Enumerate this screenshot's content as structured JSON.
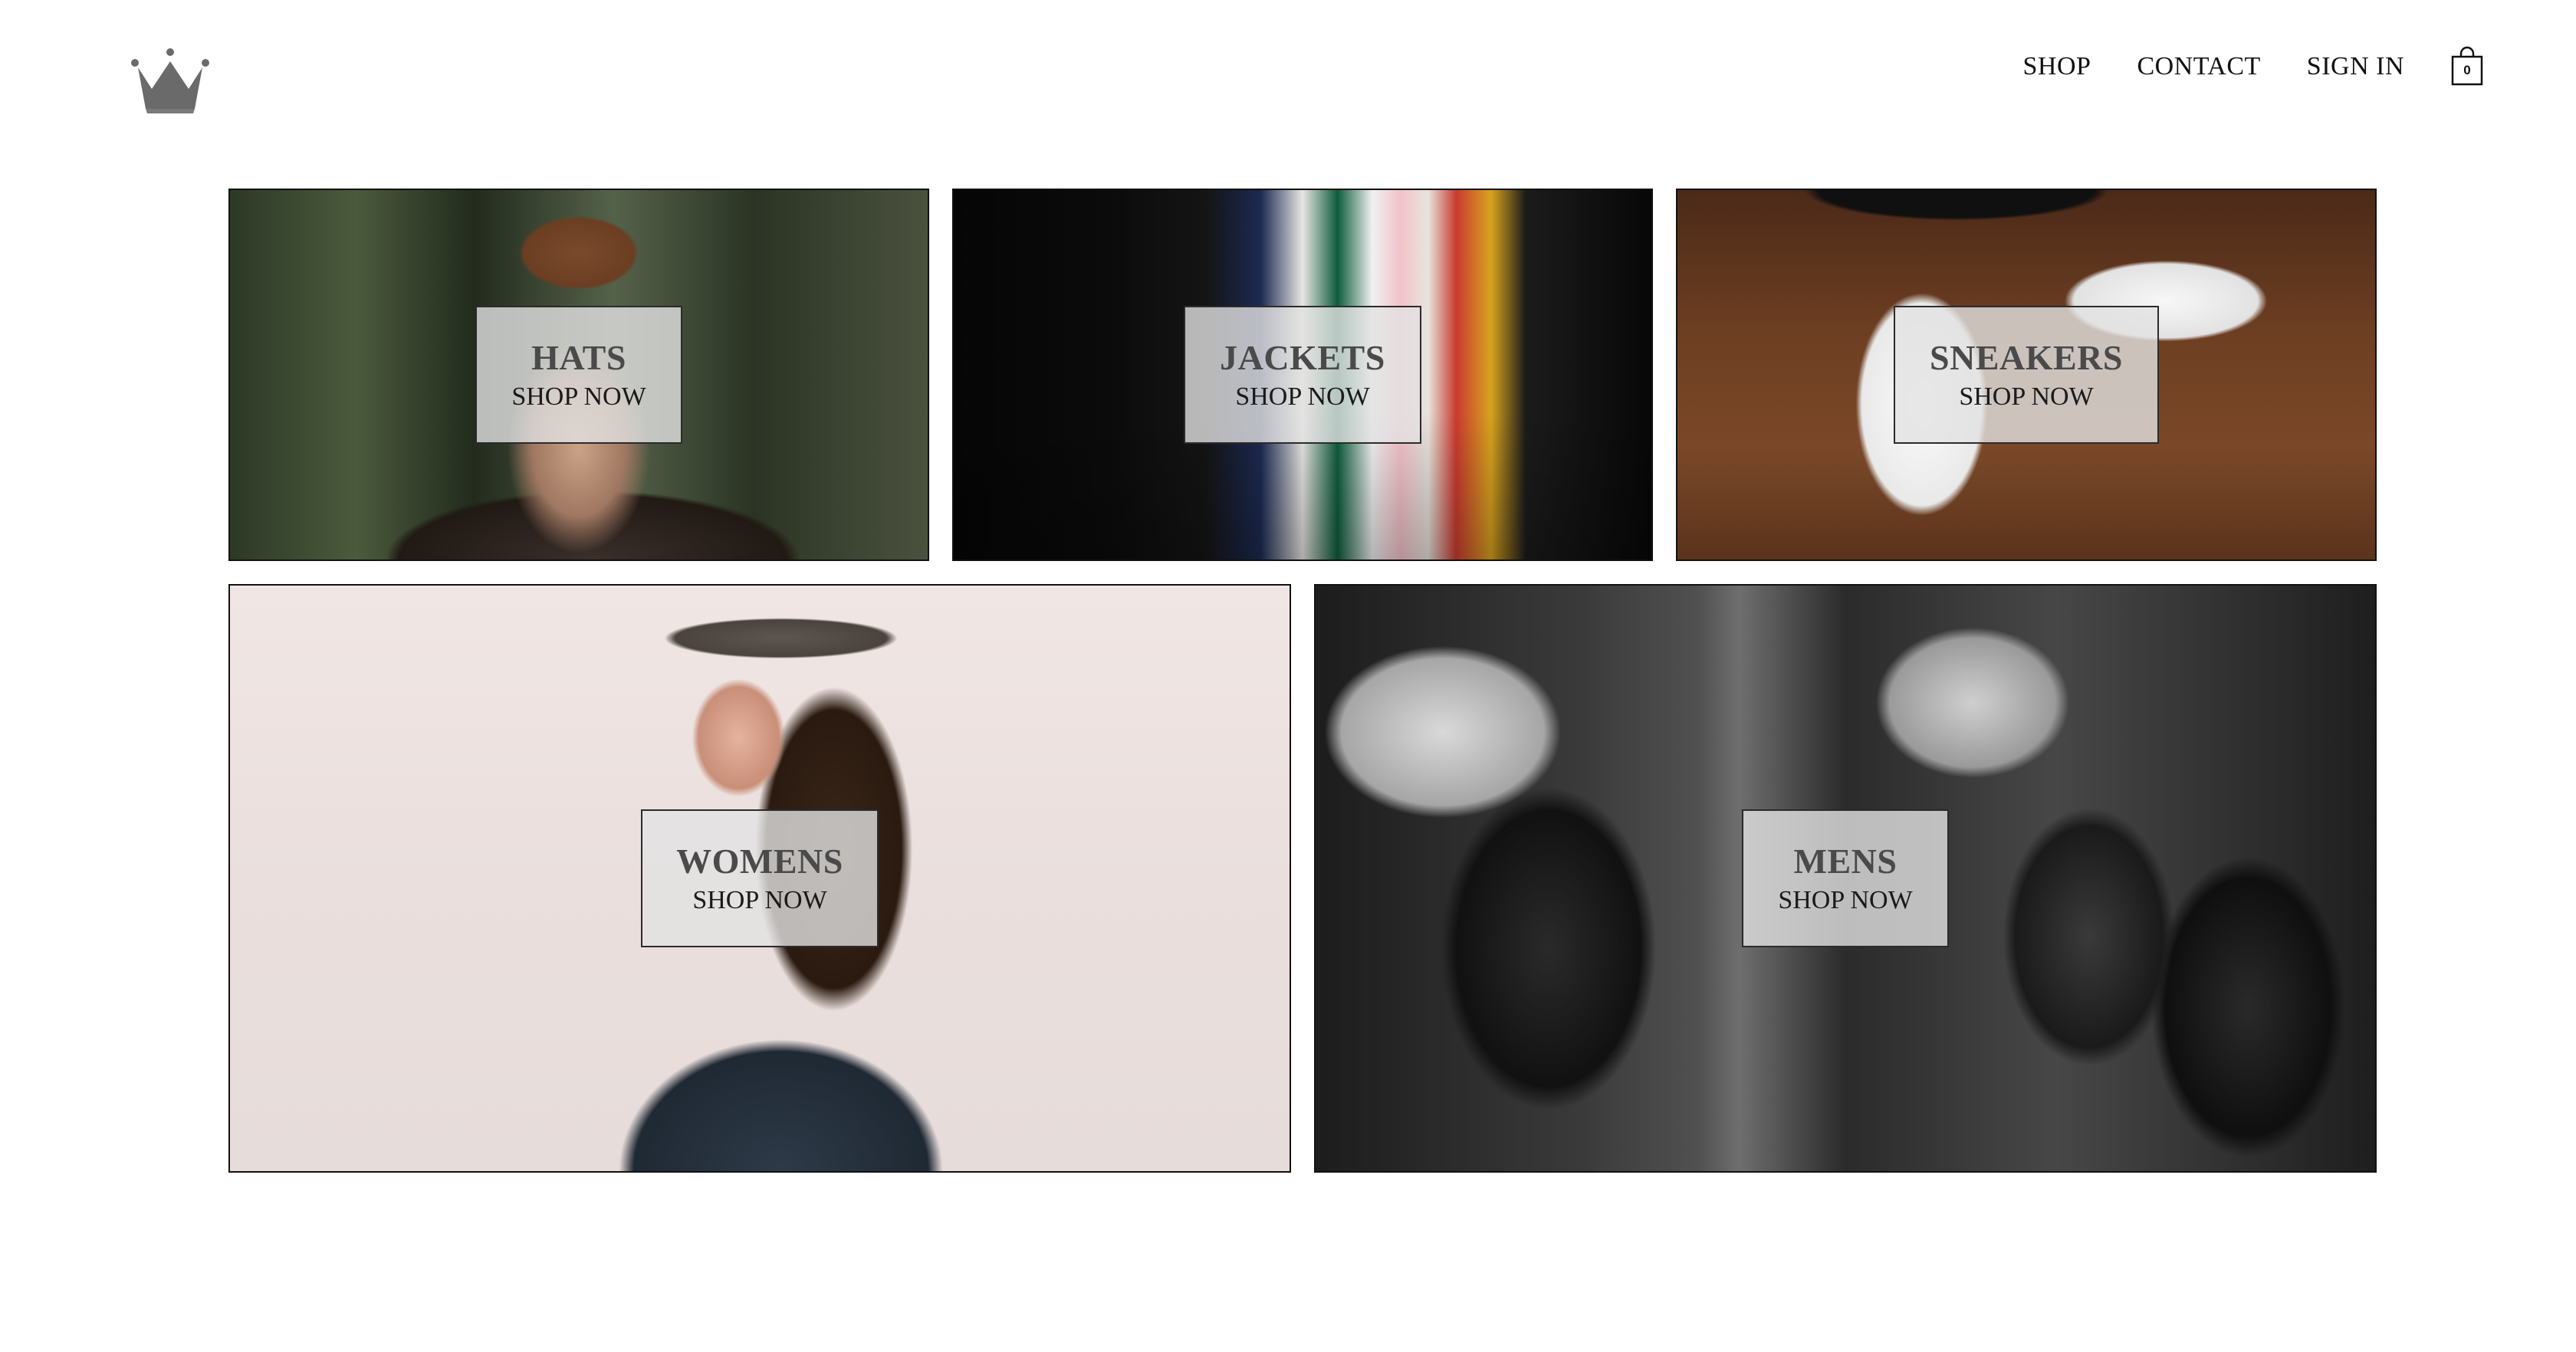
{
  "header": {
    "logo_icon": "crown-icon",
    "nav": [
      {
        "label": "SHOP"
      },
      {
        "label": "CONTACT"
      },
      {
        "label": "SIGN IN"
      }
    ],
    "cart": {
      "icon": "shopping-bag-icon",
      "count": "0"
    }
  },
  "categories": [
    {
      "title": "HATS",
      "cta": "SHOP NOW"
    },
    {
      "title": "JACKETS",
      "cta": "SHOP NOW"
    },
    {
      "title": "SNEAKERS",
      "cta": "SHOP NOW"
    },
    {
      "title": "WOMENS",
      "cta": "SHOP NOW"
    },
    {
      "title": "MENS",
      "cta": "SHOP NOW"
    }
  ]
}
